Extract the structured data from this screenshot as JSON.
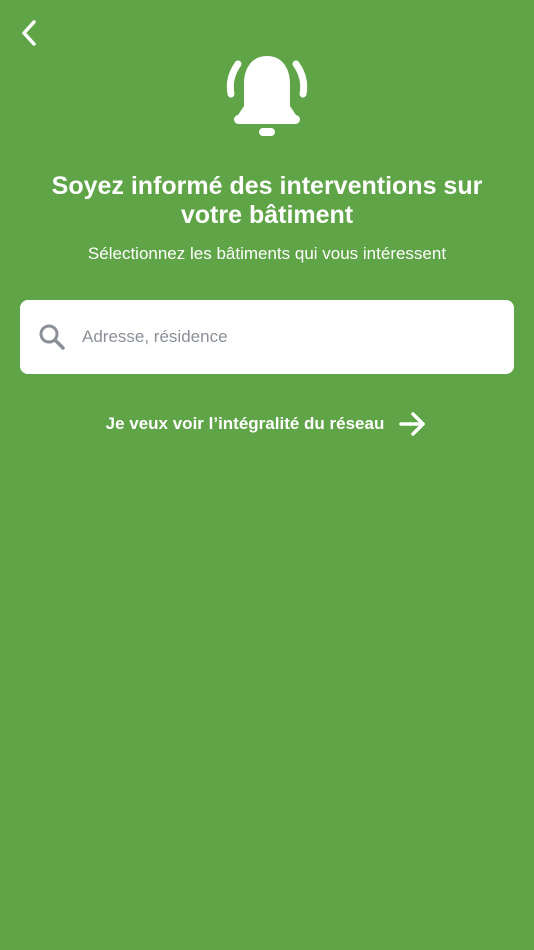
{
  "header": {
    "back_icon": "chevron-left-icon"
  },
  "hero": {
    "icon": "bell-icon",
    "title": "Soyez informé des interventions sur votre bâtiment",
    "subtitle": "Sélectionnez les bâtiments qui vous intéressent"
  },
  "search": {
    "icon": "search-icon",
    "placeholder": "Adresse, résidence",
    "value": ""
  },
  "network_link": {
    "label": "Je veux voir l’intégralité du réseau",
    "icon": "arrow-right-icon"
  },
  "colors": {
    "background": "#5fa446",
    "foreground": "#ffffff",
    "search_icon": "#8a8f98"
  }
}
